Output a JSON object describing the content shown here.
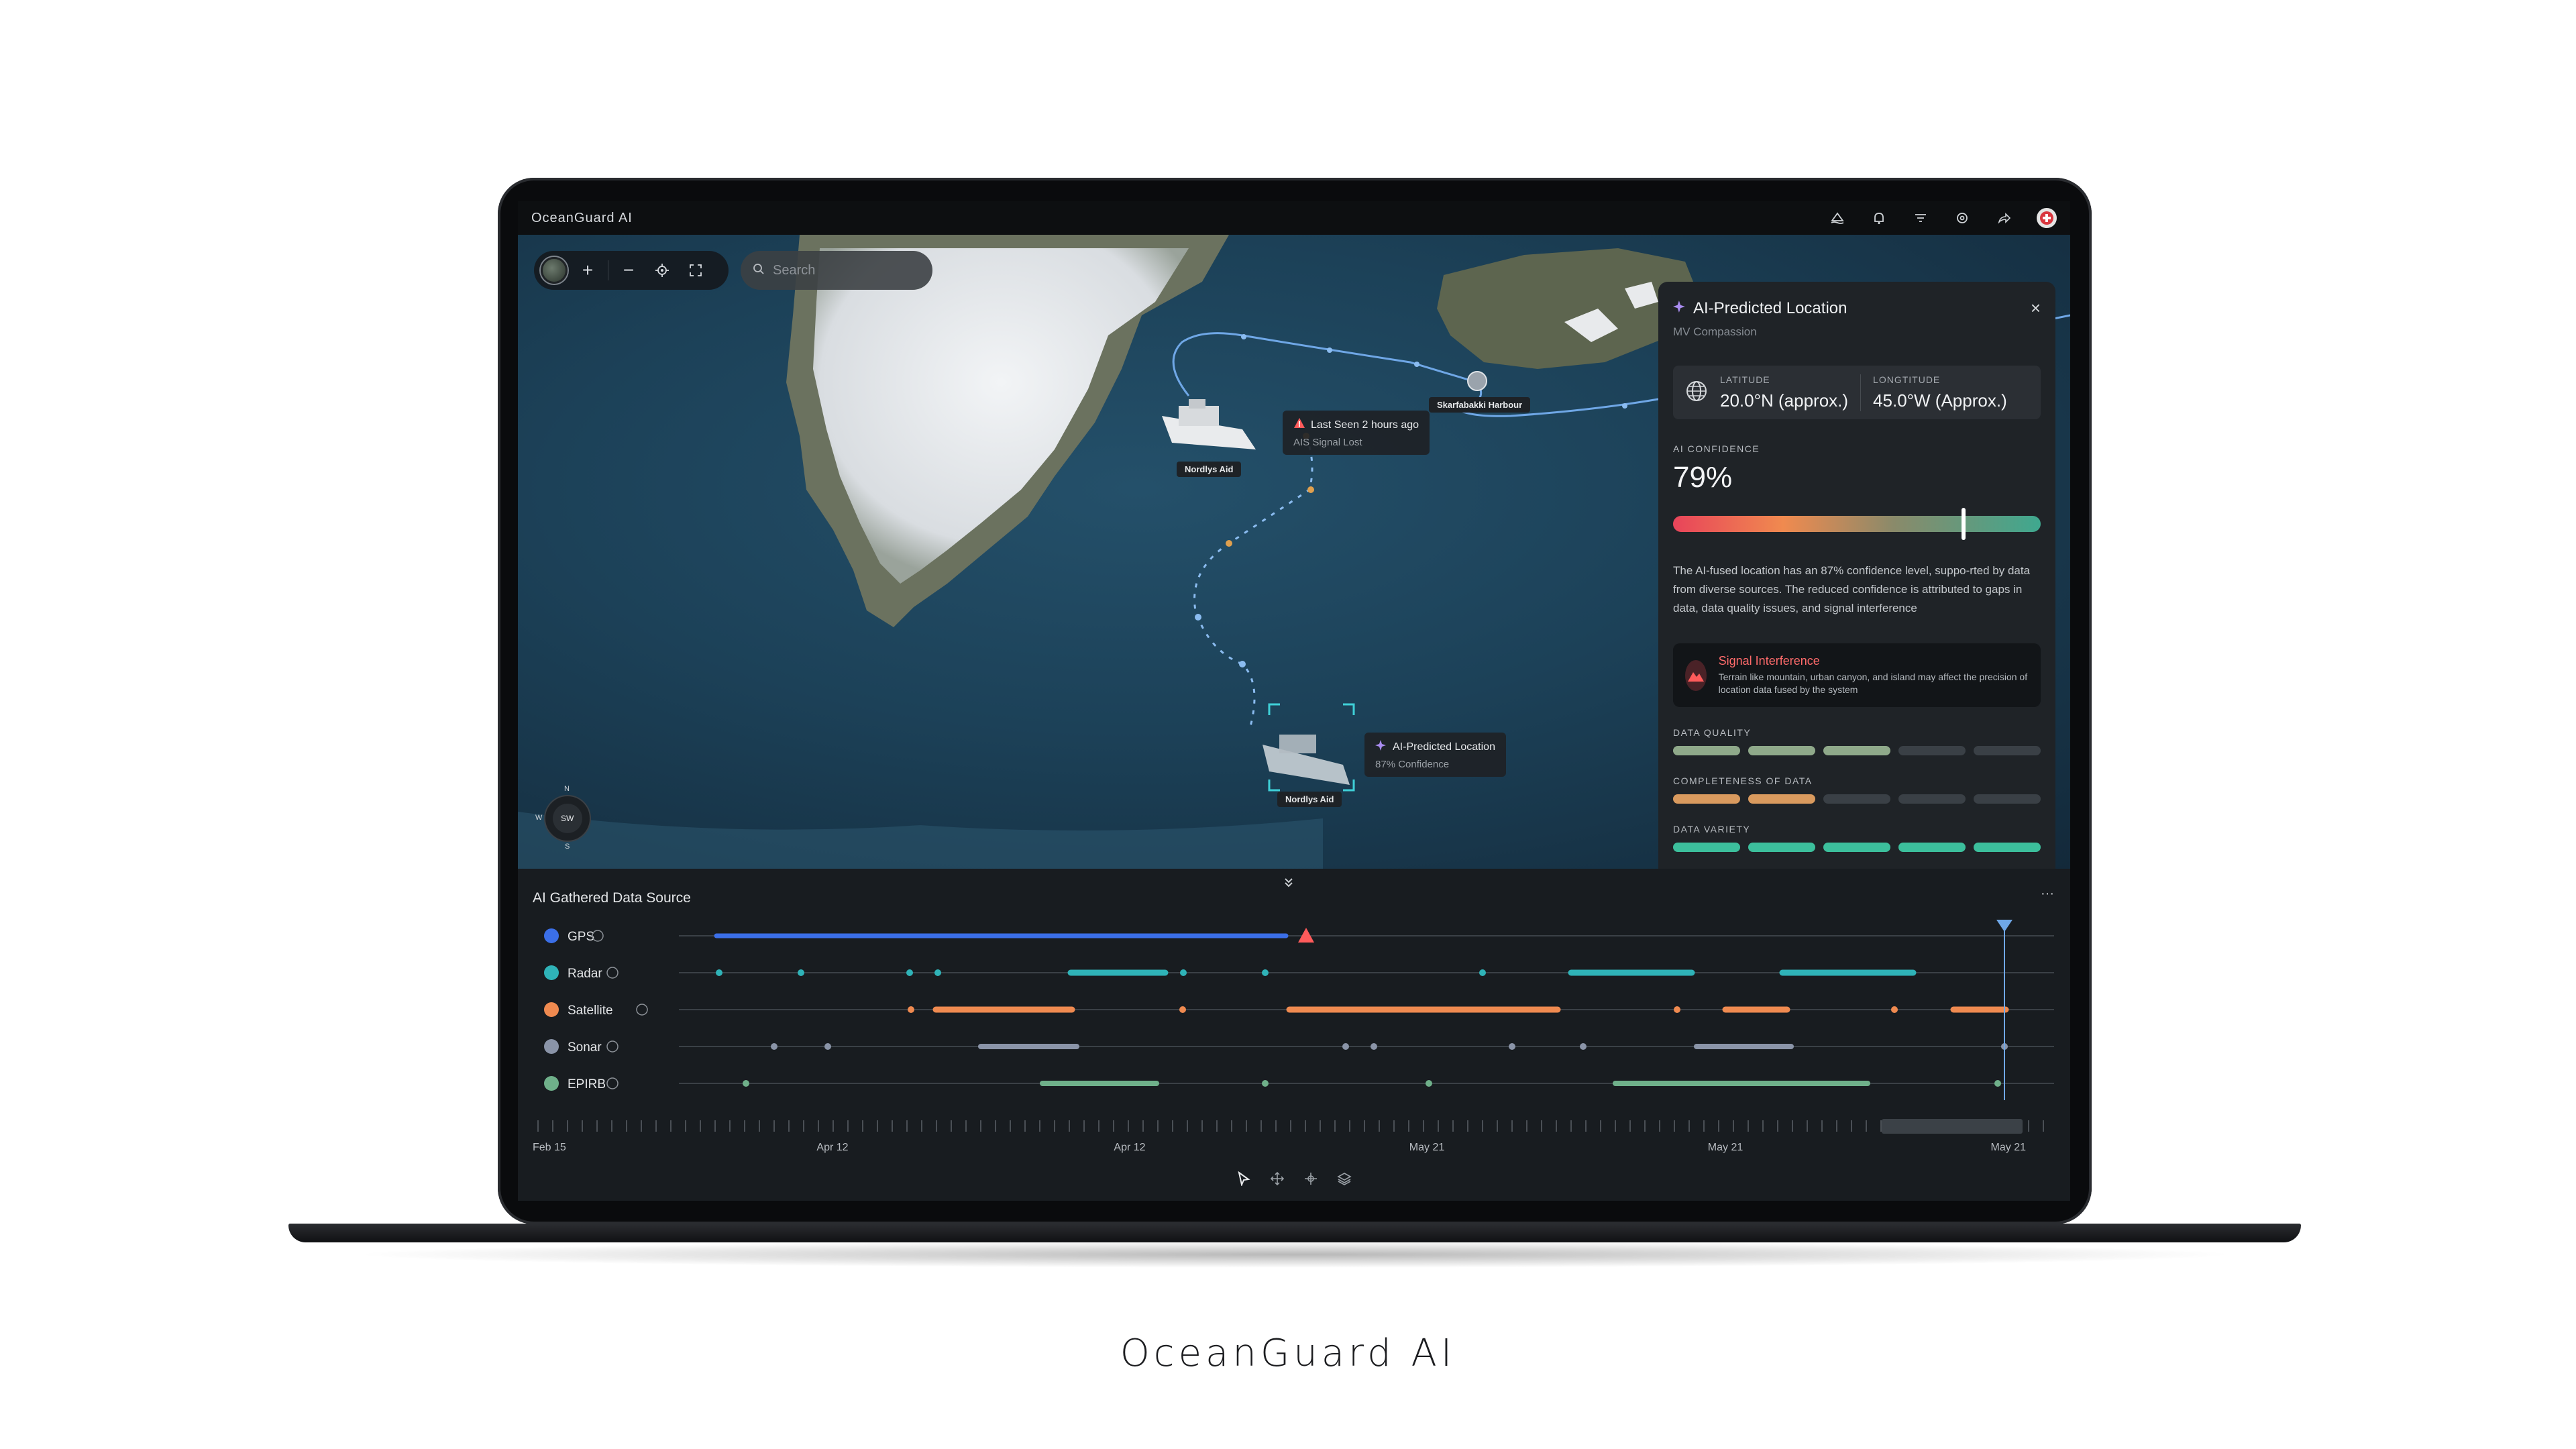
{
  "app": {
    "title": "OceanGuard AI",
    "brand_caption": "OceanGuard AI"
  },
  "topbar_icons": [
    "ship-alert-icon",
    "bell-icon",
    "filter-icon",
    "settings-icon",
    "share-icon",
    "avatar"
  ],
  "map": {
    "search_placeholder": "Search",
    "compass": {
      "n": "N",
      "s": "S",
      "w": "W",
      "dir": "SW"
    },
    "harbour_label": "Skarfabakki Harbour",
    "ship_top_label": "Nordlys Aid",
    "ship_bottom_label": "Nordlys Aid",
    "last_seen": {
      "title": "Last Seen 2 hours ago",
      "sub": "AIS Signal Lost"
    },
    "ai_predicted": {
      "title": "AI-Predicted Location",
      "sub": "87% Confidence"
    }
  },
  "panel": {
    "title": "AI-Predicted Location",
    "subtitle": "MV Compassion",
    "latitude_label": "LATITUDE",
    "latitude_value": "20.0°N (approx.)",
    "longitude_label": "LONGTITUDE",
    "longitude_value": "45.0°W (Approx.)",
    "confidence_label": "AI CONFIDENCE",
    "confidence_value": "79%",
    "confidence_fraction": 0.79,
    "description": "The AI-fused location has an 87% confidence level, suppo-rted by data from diverse sources. The reduced confidence is attributed to gaps in data, data quality issues, and signal interference",
    "alert_title": "Signal Interference",
    "alert_desc": "Terrain like mountain, urban canyon, and island may affect the precision of location data fused by the system",
    "metrics": [
      {
        "label": "DATA QUALITY",
        "filled": 3,
        "total": 5,
        "color": "#8fa98a"
      },
      {
        "label": "COMPLETENESS OF DATA",
        "filled": 2,
        "total": 5,
        "color": "#d99a5e"
      },
      {
        "label": "DATA VARIETY",
        "filled": 5,
        "total": 5,
        "color": "#3cbf9c"
      }
    ]
  },
  "timeline": {
    "title": "AI Gathered Data Source",
    "sources": [
      {
        "name": "GPS",
        "color": "#3b6fe8"
      },
      {
        "name": "Radar",
        "color": "#2fb3b8"
      },
      {
        "name": "Satellite",
        "color": "#ef8a50"
      },
      {
        "name": "Sonar",
        "color": "#8a94a8"
      },
      {
        "name": "EPIRB",
        "color": "#6fb08a"
      }
    ],
    "dates": [
      "Feb 15",
      "Apr 12",
      "Apr 12",
      "May 21",
      "May 21",
      "May 21"
    ]
  },
  "tools": [
    "cursor-icon",
    "move-icon",
    "crosshair-icon",
    "layers-icon"
  ]
}
